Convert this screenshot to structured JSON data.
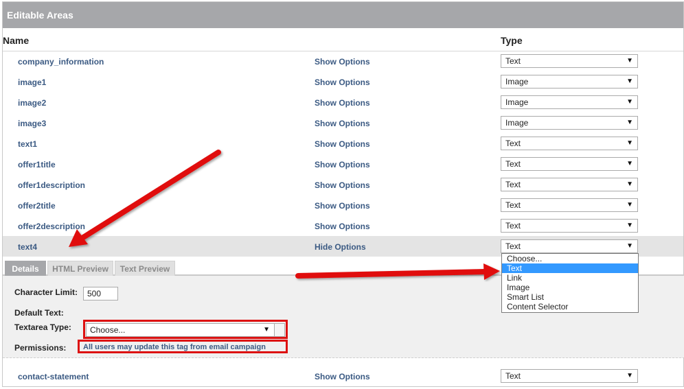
{
  "panel": {
    "title": "Editable Areas"
  },
  "columns": {
    "name": "Name",
    "type": "Type"
  },
  "rows": [
    {
      "name": "company_information",
      "option": "Show Options",
      "type": "Text"
    },
    {
      "name": "image1",
      "option": "Show Options",
      "type": "Image"
    },
    {
      "name": "image2",
      "option": "Show Options",
      "type": "Image"
    },
    {
      "name": "image3",
      "option": "Show Options",
      "type": "Image"
    },
    {
      "name": "text1",
      "option": "Show Options",
      "type": "Text"
    },
    {
      "name": "offer1title",
      "option": "Show Options",
      "type": "Text"
    },
    {
      "name": "offer1description",
      "option": "Show Options",
      "type": "Text"
    },
    {
      "name": "offer2title",
      "option": "Show Options",
      "type": "Text"
    },
    {
      "name": "offer2description",
      "option": "Show Options",
      "type": "Text"
    },
    {
      "name": "text4",
      "option": "Hide Options",
      "type": "Text"
    },
    {
      "name": "contact-statement",
      "option": "Show Options",
      "type": "Text"
    }
  ],
  "dropdown": {
    "options": [
      "Choose...",
      "Text",
      "Link",
      "Image",
      "Smart List",
      "Content Selector"
    ],
    "highlighted": "Text"
  },
  "tabs": [
    "Details",
    "HTML Preview",
    "Text Preview"
  ],
  "details": {
    "char_limit_label": "Character Limit:",
    "char_limit_value": "500",
    "default_text_label": "Default Text:",
    "textarea_type_label": "Textarea Type:",
    "textarea_type_value": "Choose...",
    "permissions_label": "Permissions:",
    "permissions_value": "All users may update this tag from email campaign"
  },
  "icons": {
    "dropdown_arrow": "▼"
  },
  "colors": {
    "header_bg": "#a6a7aa",
    "link": "#3b5a83",
    "highlight": "#3399ff",
    "annotation": "#dd1111"
  }
}
